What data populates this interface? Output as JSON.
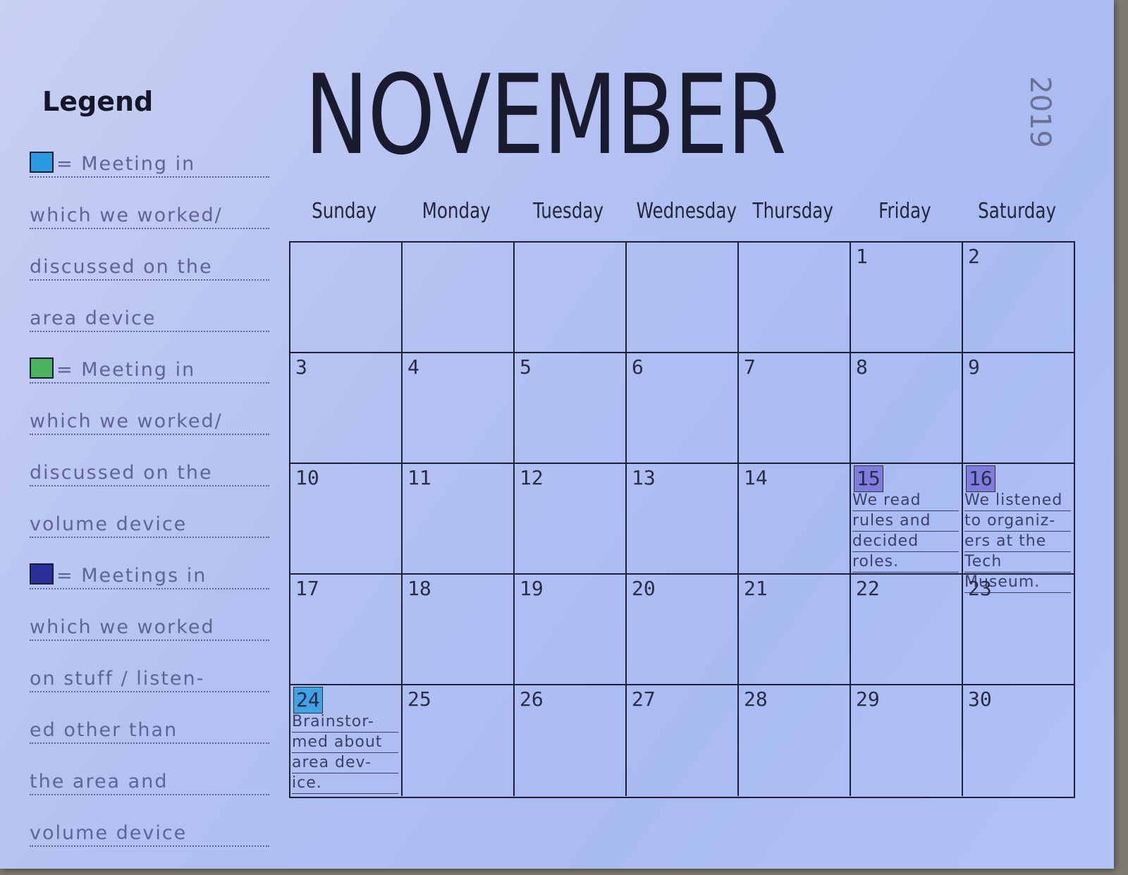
{
  "title": "NOVEMBER",
  "year": "2019",
  "legend": {
    "title": "Legend",
    "entries": [
      {
        "color": "#2a9be0",
        "lines": [
          "= Meeting in",
          "which we worked/",
          "discussed on the",
          "area device"
        ]
      },
      {
        "color": "#4bb35d",
        "lines": [
          "= Meeting in",
          "which we worked/",
          "discussed on the",
          "volume device"
        ]
      },
      {
        "color": "#2b2f9c",
        "lines": [
          "= Meetings in",
          "which we worked",
          "on stuff / listen-",
          "ed other than",
          "the area and",
          "volume device"
        ]
      }
    ]
  },
  "weekdays": [
    "Sunday",
    "Monday",
    "Tuesday",
    "Wednesday",
    "Thursday",
    "Friday",
    "Saturday"
  ],
  "weeks": [
    [
      {
        "day": ""
      },
      {
        "day": ""
      },
      {
        "day": ""
      },
      {
        "day": ""
      },
      {
        "day": ""
      },
      {
        "day": "1"
      },
      {
        "day": "2"
      }
    ],
    [
      {
        "day": "3"
      },
      {
        "day": "4"
      },
      {
        "day": "5"
      },
      {
        "day": "6"
      },
      {
        "day": "7"
      },
      {
        "day": "8"
      },
      {
        "day": "9"
      }
    ],
    [
      {
        "day": "10"
      },
      {
        "day": "11"
      },
      {
        "day": "12"
      },
      {
        "day": "13"
      },
      {
        "day": "14"
      },
      {
        "day": "15",
        "highlight": "purple",
        "note": [
          "We read",
          "rules and",
          "decided",
          "roles."
        ]
      },
      {
        "day": "16",
        "highlight": "purple",
        "note": [
          "We listened",
          "to organiz-",
          "ers at the",
          "Tech",
          "Museum."
        ]
      }
    ],
    [
      {
        "day": "17"
      },
      {
        "day": "18"
      },
      {
        "day": "19"
      },
      {
        "day": "20"
      },
      {
        "day": "21"
      },
      {
        "day": "22"
      },
      {
        "day": "23"
      }
    ],
    [
      {
        "day": "24",
        "highlight": "blue",
        "note": [
          "Brainstor-",
          "med about",
          "area dev-",
          "ice."
        ]
      },
      {
        "day": "25"
      },
      {
        "day": "26"
      },
      {
        "day": "27"
      },
      {
        "day": "28"
      },
      {
        "day": "29"
      },
      {
        "day": "30"
      }
    ]
  ]
}
